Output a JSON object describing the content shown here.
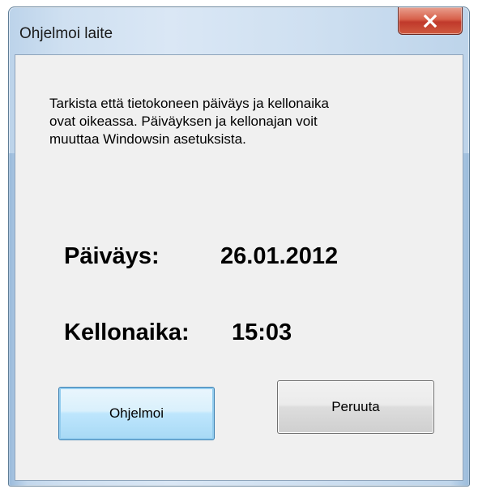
{
  "window": {
    "title": "Ohjelmoi laite"
  },
  "close_button": {
    "glyph": "X",
    "icon": "close-icon"
  },
  "message": "Tarkista että tietokoneen päiväys ja kellonaika\novat oikeassa. Päiväyksen ja kellonajan voit\nmuuttaa Windowsin asetuksista.",
  "date": {
    "label": "Päiväys:",
    "value": "26.01.2012"
  },
  "time": {
    "label": "Kellonaika:",
    "value": "15:03"
  },
  "buttons": {
    "program_label": "Ohjelmoi",
    "cancel_label": "Peruuta"
  },
  "colors": {
    "close_button": "#c0392b",
    "primary_button": "#bee6fd",
    "client_background": "#f0f0f0"
  }
}
